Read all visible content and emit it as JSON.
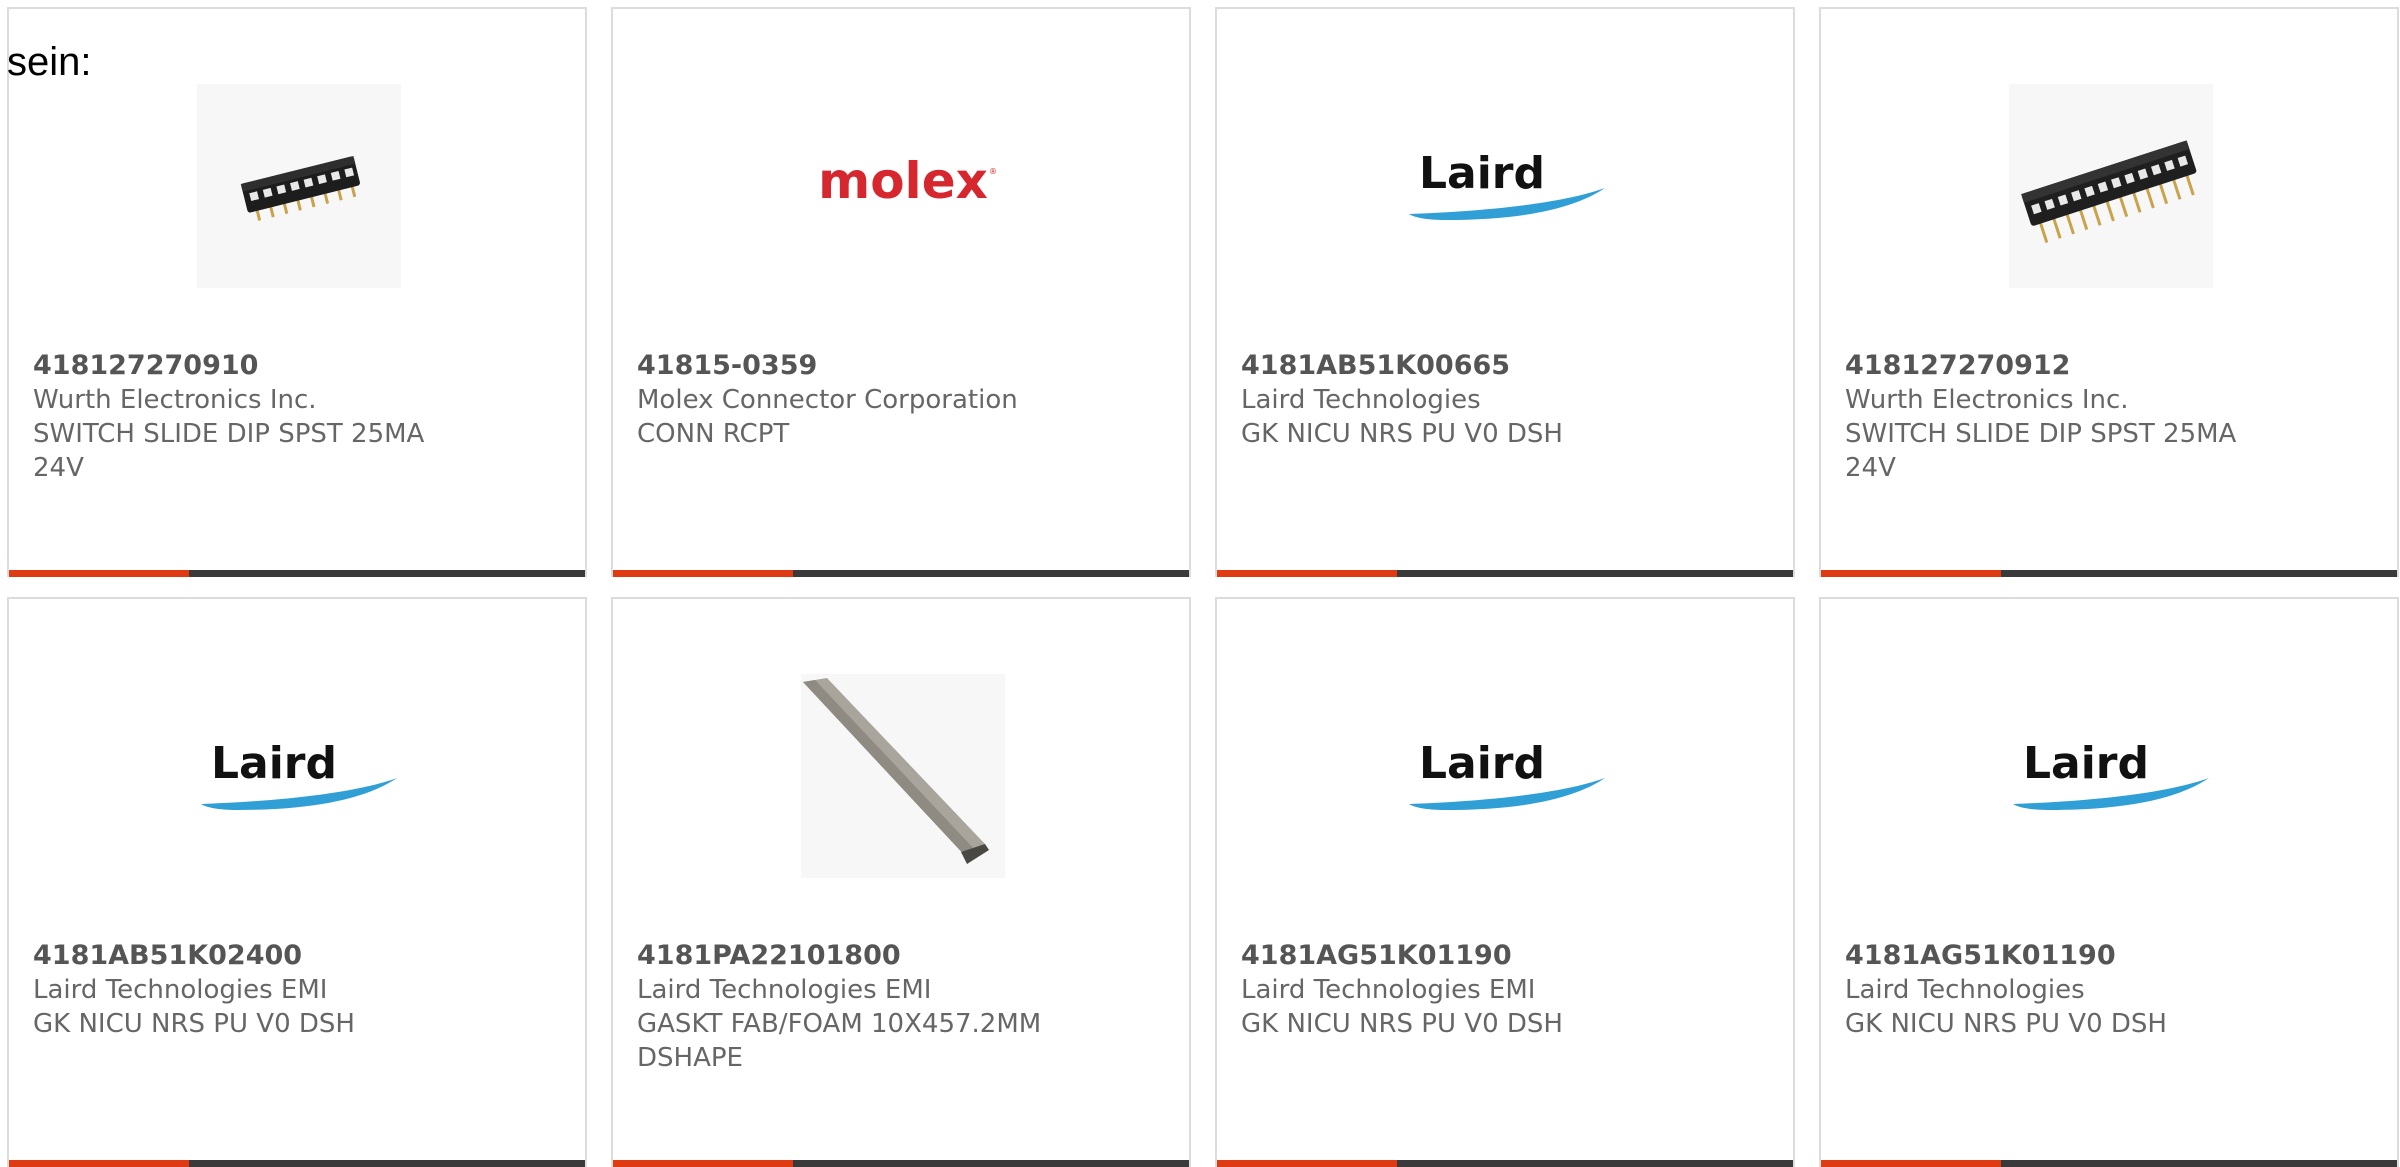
{
  "intro_text": "sein:",
  "colors": {
    "accent": "#e03a12",
    "bar": "#3a3a3a",
    "molex": "#d6262e",
    "laird_swoosh": "#2f9fd6",
    "text": "#666666"
  },
  "products": [
    {
      "part_no": "418127270910",
      "manufacturer": "Wurth Electronics Inc.",
      "description": "SWITCH SLIDE DIP SPST 25MA 24V",
      "image": "dip-switch-8pos-icon"
    },
    {
      "part_no": "41815-0359",
      "manufacturer": "Molex Connector Corporation",
      "description": "CONN RCPT",
      "image": "molex-logo",
      "logo_text": "molex"
    },
    {
      "part_no": "4181AB51K00665",
      "manufacturer": "Laird Technologies",
      "description": "GK NICU NRS PU V0 DSH",
      "image": "laird-logo",
      "logo_text": "Laird"
    },
    {
      "part_no": "418127270912",
      "manufacturer": "Wurth Electronics Inc.",
      "description": "SWITCH SLIDE DIP SPST 25MA 24V",
      "image": "dip-switch-12pos-icon"
    },
    {
      "part_no": "4181AB51K02400",
      "manufacturer": "Laird Technologies EMI",
      "description": "GK NICU NRS PU V0 DSH",
      "image": "laird-logo",
      "logo_text": "Laird"
    },
    {
      "part_no": "4181PA22101800",
      "manufacturer": "Laird Technologies EMI",
      "description": "GASKT FAB/FOAM 10X457.2MM DSHAPE",
      "image": "foam-gasket-icon"
    },
    {
      "part_no": "4181AG51K01190",
      "manufacturer": "Laird Technologies EMI",
      "description": "GK NICU NRS PU V0 DSH",
      "image": "laird-logo",
      "logo_text": "Laird"
    },
    {
      "part_no": "4181AG51K01190",
      "manufacturer": "Laird Technologies",
      "description": "GK NICU NRS PU V0 DSH",
      "image": "laird-logo",
      "logo_text": "Laird"
    }
  ]
}
